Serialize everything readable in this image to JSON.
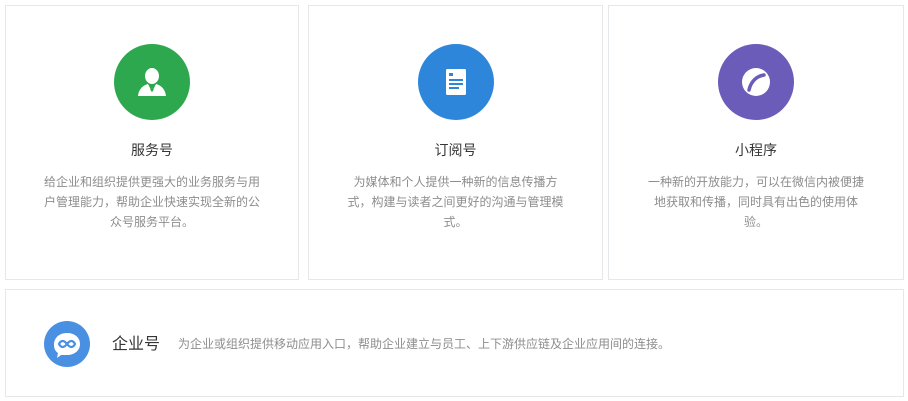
{
  "cards": [
    {
      "icon": "person-icon",
      "color": "#2ea84f",
      "title": "服务号",
      "description": "给企业和组织提供更强大的业务服务与用户管理能力，帮助企业快速实现全新的公众号服务平台。"
    },
    {
      "icon": "document-icon",
      "color": "#2d86d9",
      "title": "订阅号",
      "description": "为媒体和个人提供一种新的信息传播方式，构建与读者之间更好的沟通与管理模式。"
    },
    {
      "icon": "miniprogram-icon",
      "color": "#6a5cb8",
      "title": "小程序",
      "description": "一种新的开放能力，可以在微信内被便捷地获取和传播，同时具有出色的使用体验。"
    }
  ],
  "enterprise": {
    "icon": "enterprise-icon",
    "color": "#4a90e2",
    "title": "企业号",
    "description": "为企业或组织提供移动应用入口，帮助企业建立与员工、上下游供应链及企业应用间的连接。"
  }
}
